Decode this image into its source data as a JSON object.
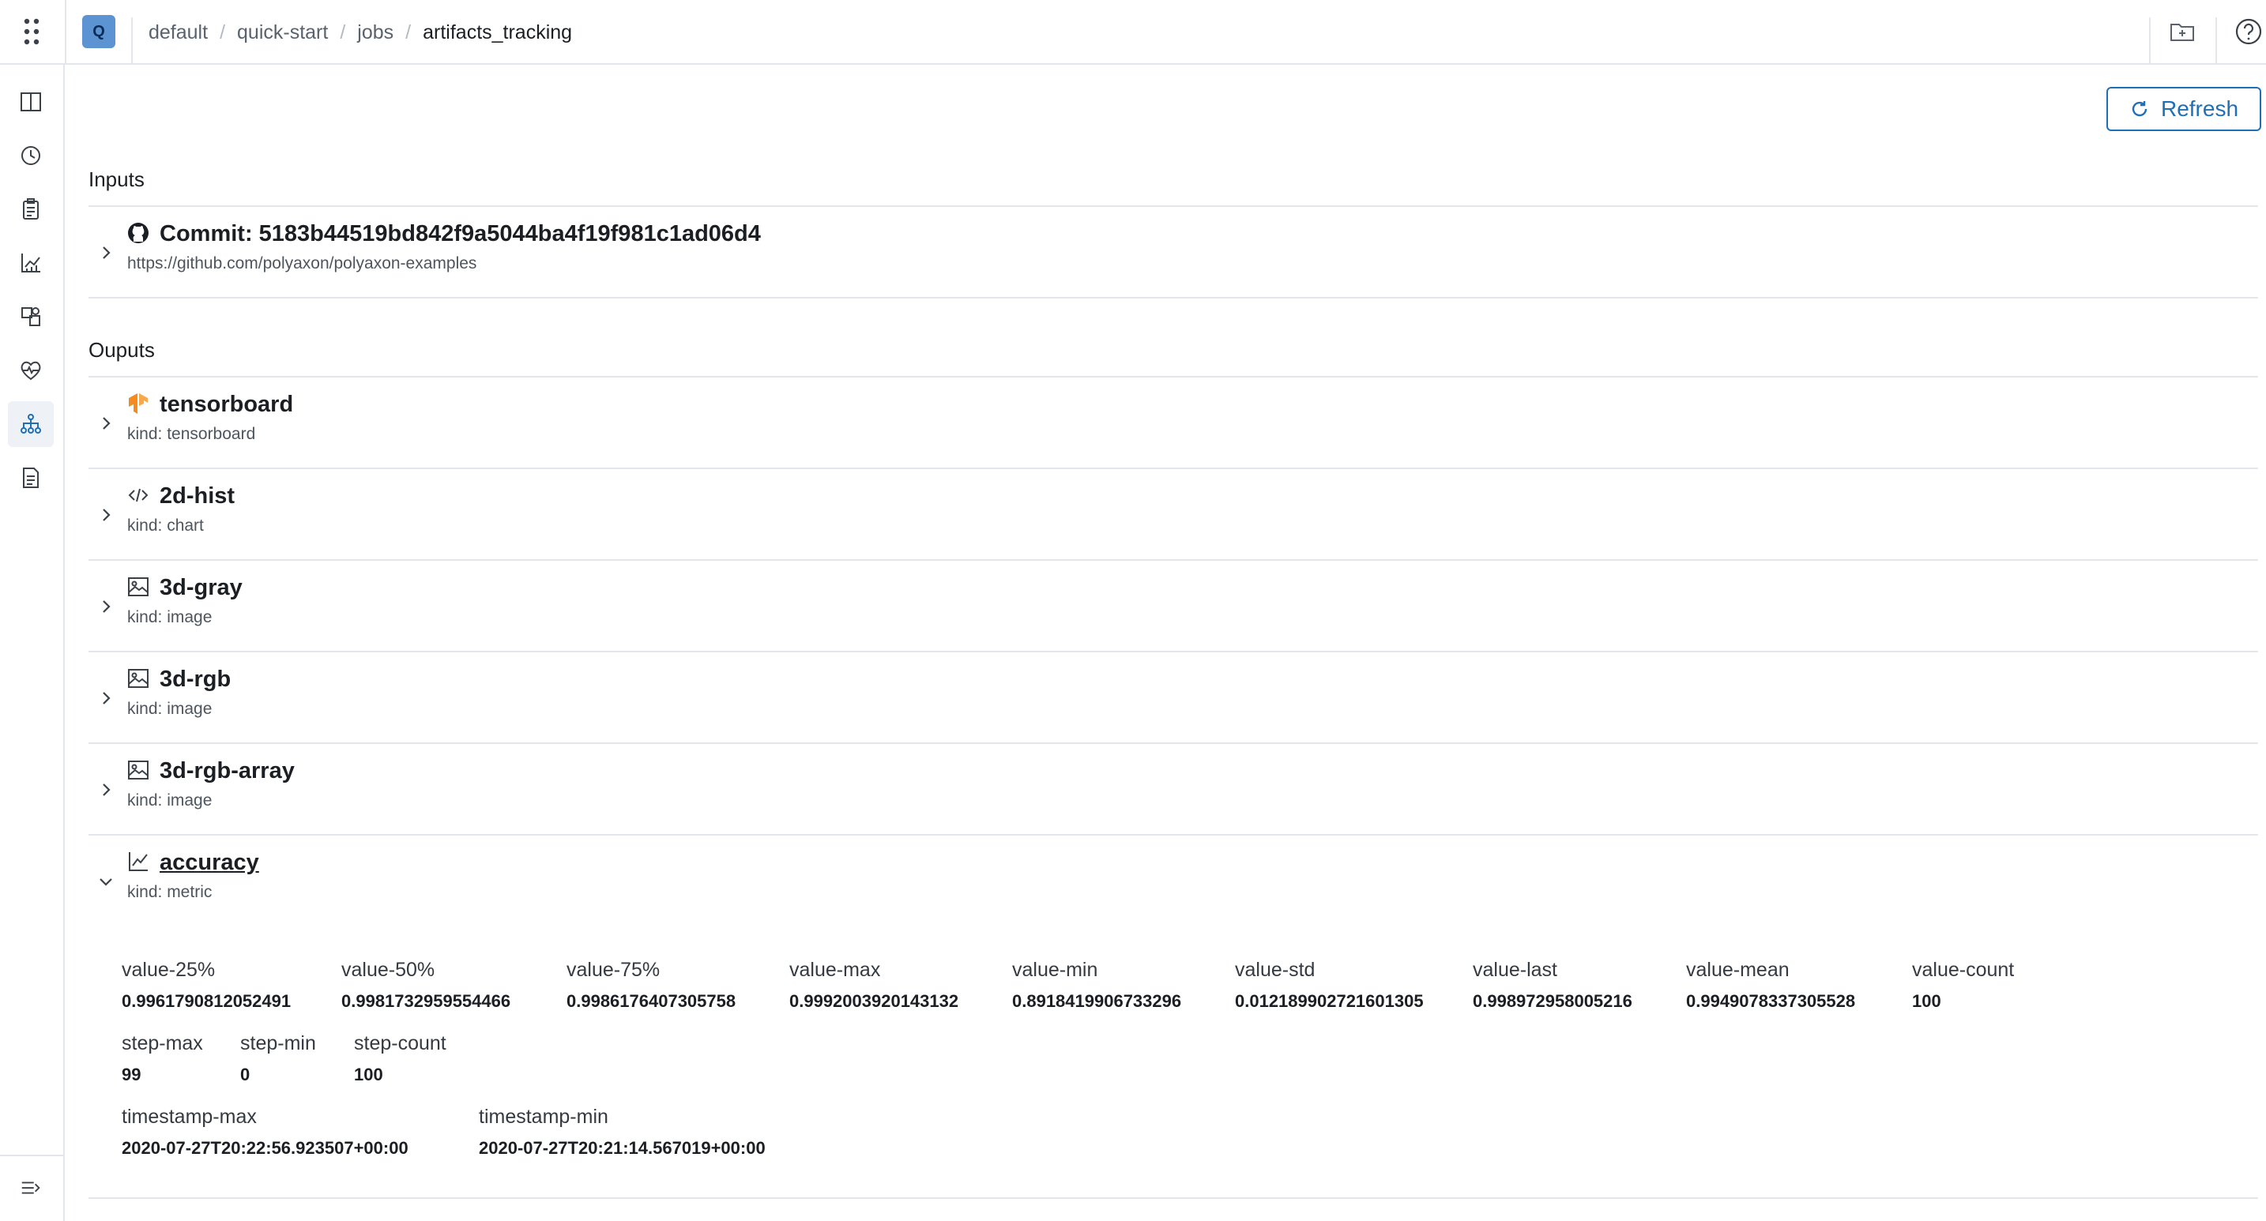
{
  "header": {
    "project_badge": "Q",
    "breadcrumb": [
      "default",
      "quick-start",
      "jobs",
      "artifacts_tracking"
    ]
  },
  "toolbar": {
    "refresh_label": "Refresh"
  },
  "inputs": {
    "title": "Inputs",
    "items": [
      {
        "title": "Commit: 5183b44519bd842f9a5044ba4f19f981c1ad06d4",
        "subtitle": "https://github.com/polyaxon/polyaxon-examples",
        "icon": "github-icon"
      }
    ]
  },
  "outputs": {
    "title": "Ouputs",
    "items": [
      {
        "title": "tensorboard",
        "subtitle": "kind: tensorboard",
        "icon": "tensorflow-icon"
      },
      {
        "title": "2d-hist",
        "subtitle": "kind: chart",
        "icon": "code-icon"
      },
      {
        "title": "3d-gray",
        "subtitle": "kind: image",
        "icon": "image-icon"
      },
      {
        "title": "3d-rgb",
        "subtitle": "kind: image",
        "icon": "image-icon"
      },
      {
        "title": "3d-rgb-array",
        "subtitle": "kind: image",
        "icon": "image-icon"
      },
      {
        "title": "accuracy",
        "subtitle": "kind: metric",
        "icon": "line-chart-icon",
        "expanded": true
      }
    ]
  },
  "accuracy_stats": {
    "row1": [
      {
        "key": "value-25%",
        "value": "0.9961790812052491"
      },
      {
        "key": "value-50%",
        "value": "0.9981732959554466"
      },
      {
        "key": "value-75%",
        "value": "0.9986176407305758"
      },
      {
        "key": "value-max",
        "value": "0.9992003920143132"
      },
      {
        "key": "value-min",
        "value": "0.8918419906733296"
      },
      {
        "key": "value-std",
        "value": "0.012189902721601305"
      },
      {
        "key": "value-last",
        "value": "0.998972958005216"
      },
      {
        "key": "value-mean",
        "value": "0.9949078337305528"
      },
      {
        "key": "value-count",
        "value": "100"
      }
    ],
    "row2": [
      {
        "key": "step-max",
        "value": "99"
      },
      {
        "key": "step-min",
        "value": "0"
      },
      {
        "key": "step-count",
        "value": "100"
      }
    ],
    "row3": [
      {
        "key": "timestamp-max",
        "value": "2020-07-27T20:22:56.923507+00:00"
      },
      {
        "key": "timestamp-min",
        "value": "2020-07-27T20:21:14.567019+00:00"
      }
    ]
  },
  "colors": {
    "accent": "#1f6fb8",
    "badge": "#5b93d3",
    "tensorflow": "#f58a1f",
    "border": "#e3e6ea"
  }
}
